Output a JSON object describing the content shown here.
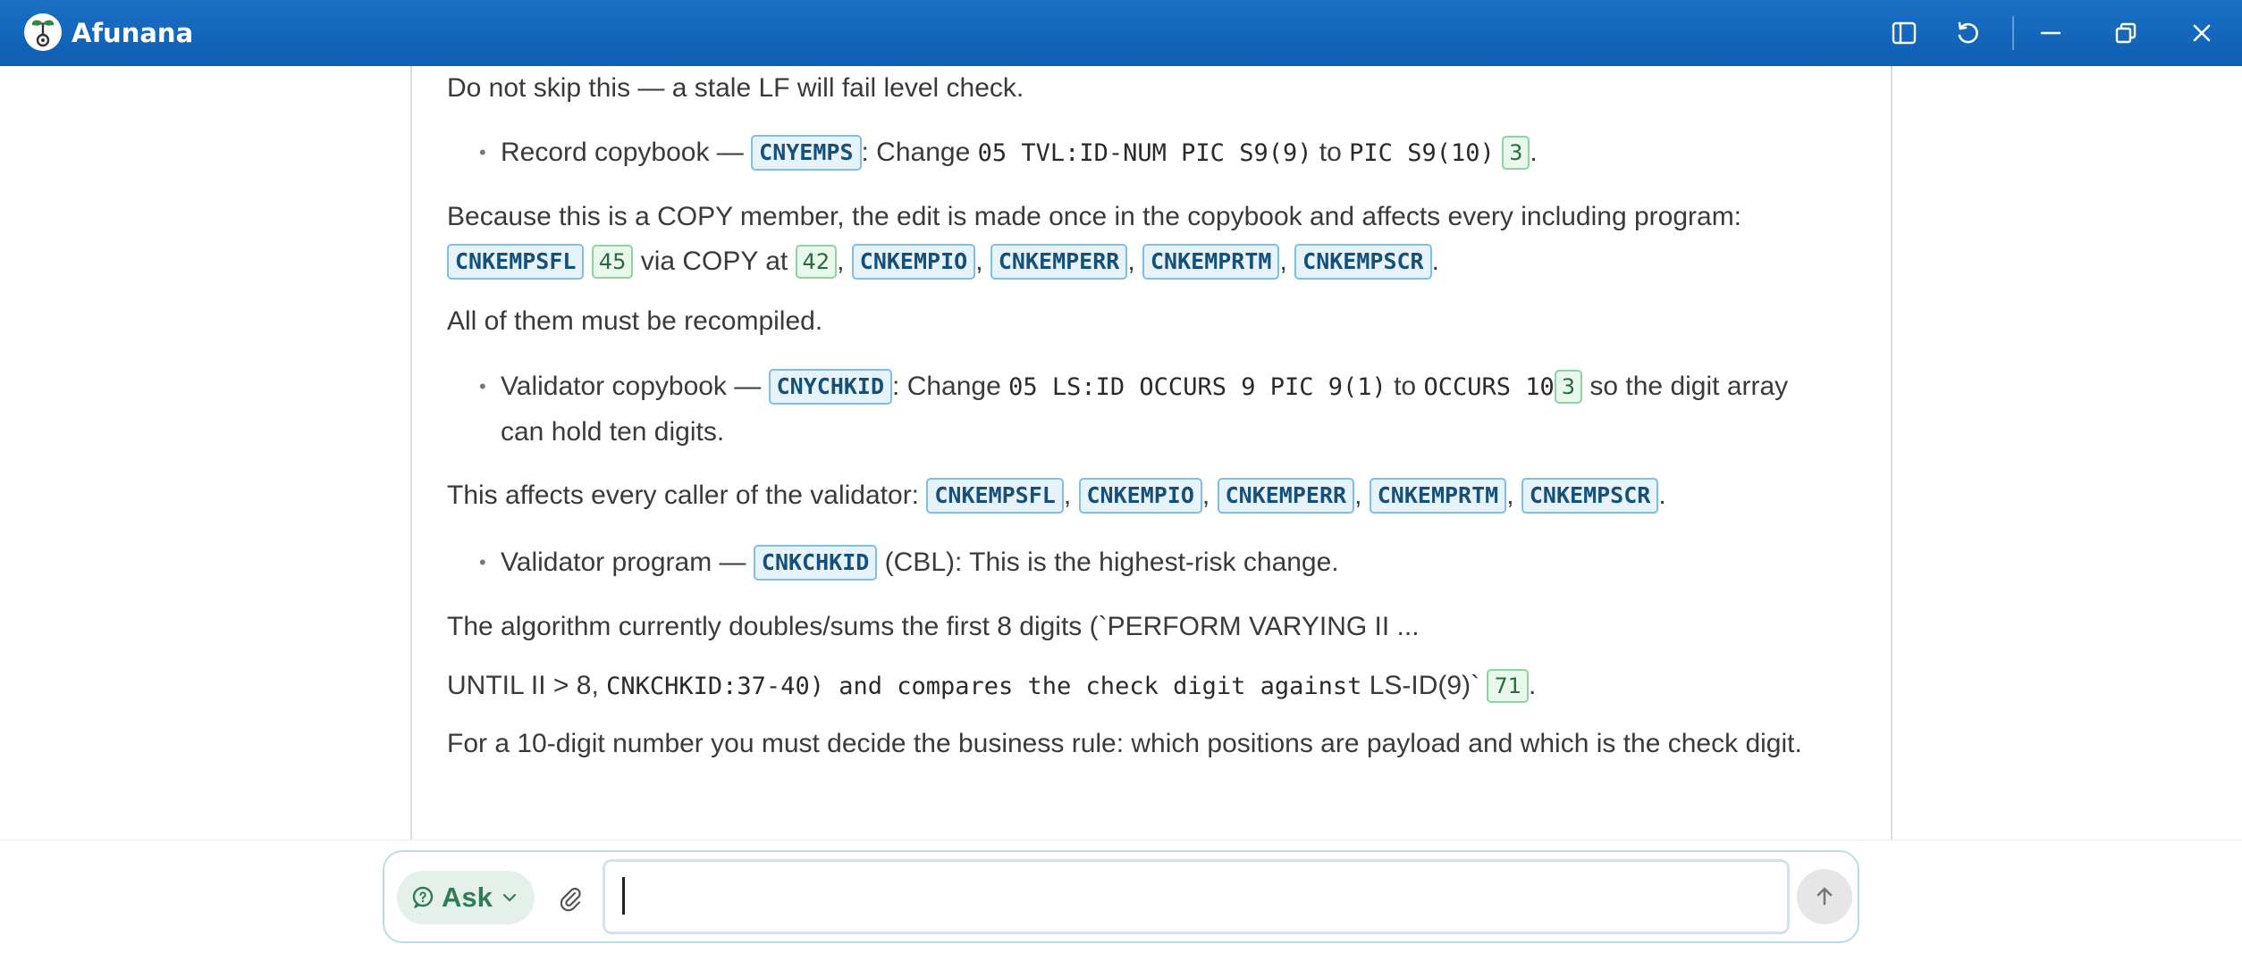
{
  "app": {
    "title": "Afunana"
  },
  "content": {
    "p1": "Do not skip this — a stale LF will fail level check.",
    "b1": {
      "lead": "Record copybook — ",
      "sym": "CNYEMPS",
      "mid": ": Change ",
      "code1": "05 TVL:ID-NUM PIC S9(9)",
      "to": " to ",
      "code2": "PIC S9(10)",
      "ref": "3",
      "end": "."
    },
    "p2": {
      "text1": "Because this is a COPY member, the edit is made once in the copybook and affects every including program:",
      "sym1": "CNKEMPSFL",
      "ref1": "45",
      "via": " via COPY at ",
      "ref2": "42",
      "sym2": "CNKEMPIO",
      "sym3": "CNKEMPERR",
      "sym4": "CNKEMPRTM",
      "sym5": "CNKEMPSCR",
      "comma": ", ",
      "end": "."
    },
    "p3": "All of them must be recompiled.",
    "b2": {
      "lead": "Validator copybook — ",
      "sym": "CNYCHKID",
      "mid": ": Change ",
      "code1": "05 LS:ID OCCURS 9 PIC 9(1)",
      "to": " to ",
      "code2": "OCCURS 10",
      "ref": "3",
      "tail": " so the digit array can hold ten digits."
    },
    "p4": {
      "text": "This affects every caller of the validator: ",
      "sym1": "CNKEMPSFL",
      "sym2": "CNKEMPIO",
      "sym3": "CNKEMPERR",
      "sym4": "CNKEMPRTM",
      "sym5": "CNKEMPSCR",
      "comma": ", ",
      "end": "."
    },
    "b3": {
      "lead": "Validator program — ",
      "sym": "CNKCHKID",
      "tail": " (CBL): This is the highest-risk change."
    },
    "p5": "The algorithm currently doubles/sums the first 8 digits (`PERFORM VARYING II ...",
    "p6": {
      "text": "UNTIL II > 8, ",
      "code": "CNKCHKID:37-40) and compares the check digit against",
      "tail": " LS-ID(9)`",
      "ref": "71",
      "end": "."
    },
    "p7": "For a 10-digit number you must decide the business rule: which positions are payload and which is the check digit."
  },
  "composer": {
    "mode_label": "Ask",
    "input_value": "",
    "placeholder": ""
  },
  "colors": {
    "titlebar": "#1565c0",
    "symbol_chip_bg": "#e7f3fb",
    "ref_chip_bg": "#e9f8ec",
    "mode_text": "#2e7d54"
  }
}
